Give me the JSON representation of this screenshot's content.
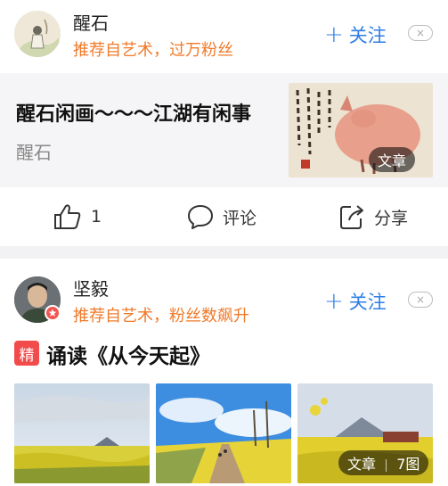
{
  "card1": {
    "author": "醒石",
    "recommendation": "推荐自艺术，过万粉丝",
    "follow_label": "关注",
    "follow_plus": "+",
    "close_glyph": "×",
    "article": {
      "title": "醒石闲画～～～江湖有闲事",
      "source": "醒石",
      "thumb_tag": "文章"
    },
    "actions": {
      "like_count": "1",
      "comment_label": "评论",
      "share_label": "分享"
    }
  },
  "card2": {
    "author": "坚毅",
    "recommendation": "推荐自艺术，粉丝数飙升",
    "follow_label": "关注",
    "follow_plus": "+",
    "close_glyph": "×",
    "badge": "精",
    "title": "诵读《从今天起》",
    "image_tag_type": "文章",
    "image_tag_count": "7图"
  },
  "colors": {
    "accent_orange": "#f07a2a",
    "follow_blue": "#2f7ee6",
    "badge_red": "#f24b4b"
  }
}
